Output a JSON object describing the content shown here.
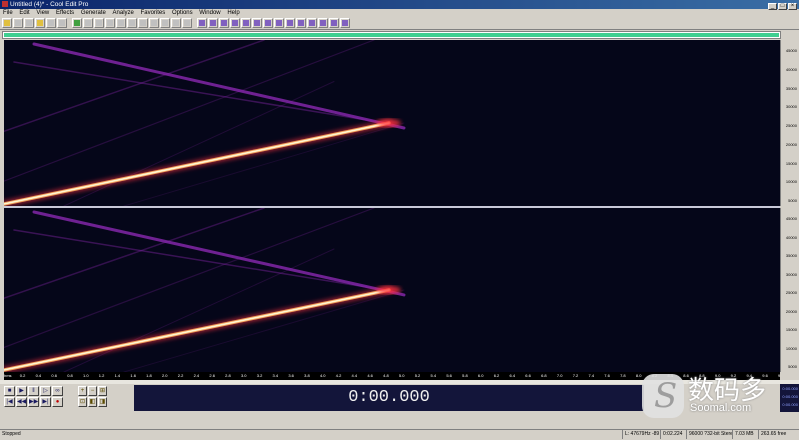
{
  "window": {
    "title": "Untitled (4)* - Cool Edit Pro"
  },
  "menu": [
    "File",
    "Edit",
    "View",
    "Effects",
    "Generate",
    "Analyze",
    "Favorites",
    "Options",
    "Window",
    "Help"
  ],
  "spectrogram": {
    "colors": {
      "background": "#050619",
      "sweep": "#fff6d0",
      "glow": "#ff3040",
      "alias": "#8a28b0"
    },
    "top_channel_ruler": [
      "45000",
      "40000",
      "35000",
      "30000",
      "25000",
      "20000",
      "15000",
      "10000",
      "5000"
    ],
    "bottom_channel_ruler": [
      "45000",
      "40000",
      "35000",
      "30000",
      "25000",
      "20000",
      "15000",
      "10000",
      "5000"
    ]
  },
  "time_ruler": [
    "hms",
    "0.2",
    "0.4",
    "0.6",
    "0.8",
    "1.0",
    "1.2",
    "1.4",
    "1.6",
    "1.8",
    "2.0",
    "2.2",
    "2.4",
    "2.6",
    "2.8",
    "3.0",
    "3.2",
    "3.4",
    "3.6",
    "3.8",
    "4.0",
    "4.2",
    "4.4",
    "4.6",
    "4.8",
    "5.0",
    "5.2",
    "5.4",
    "5.6",
    "5.8",
    "6.0",
    "6.2",
    "6.4",
    "6.6",
    "6.8",
    "7.0",
    "7.2",
    "7.4",
    "7.6",
    "7.8",
    "8.0",
    "8.2",
    "8.4",
    "8.6",
    "8.8",
    "9.0",
    "9.2",
    "9.4",
    "9.6",
    "9.8",
    "hms"
  ],
  "time_display": "0:00.000",
  "selection_info": [
    "0:00.000",
    "0:00.000",
    "0:00.000"
  ],
  "status": {
    "state": "Stopped",
    "level": "L: 47679Hz -89",
    "time": "0:02.224",
    "format": "96000 ?32-bit Stereo",
    "size": "7.03 MB",
    "free": "263.65 free"
  },
  "watermark": {
    "cn": "数码多",
    "en": "Soomal.com"
  }
}
